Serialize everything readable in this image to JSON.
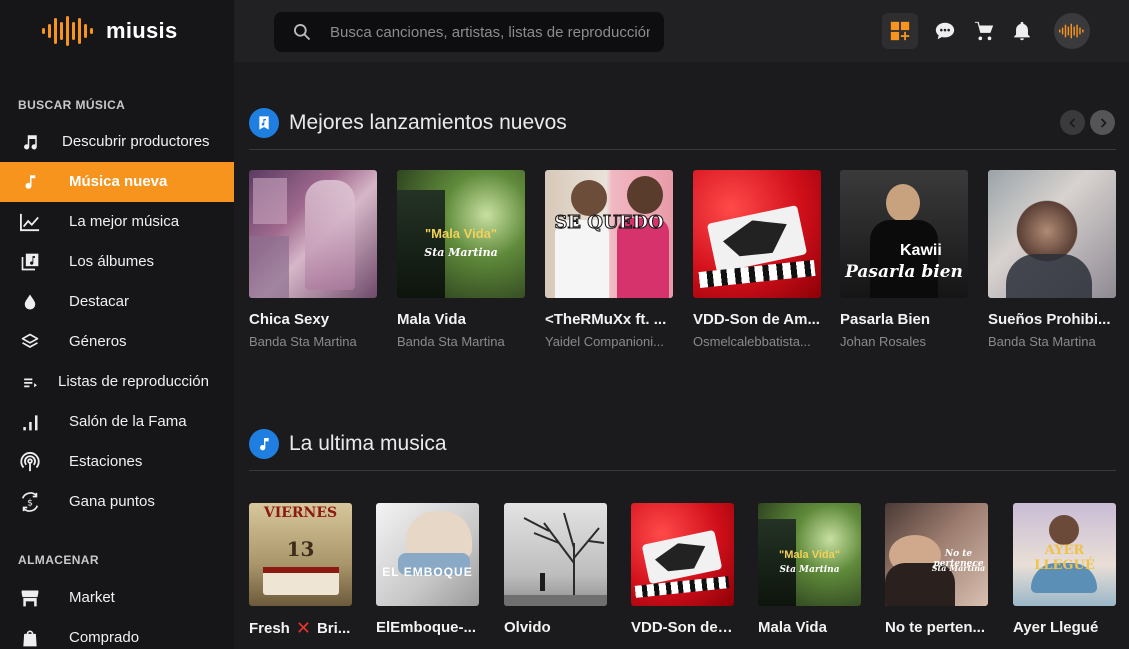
{
  "brand": {
    "name": "miusis",
    "accent": "#f7941d",
    "blue": "#1f7fe0"
  },
  "search": {
    "placeholder": "Busca canciones, artistas, listas de reproducción"
  },
  "sidebar": {
    "section_buscar": "BUSCAR MÚSICA",
    "section_almacenar": "ALMACENAR",
    "items": [
      {
        "label": "Descubrir productores",
        "icon": "music-note-icon"
      },
      {
        "label": "Música nueva",
        "icon": "music-note-icon",
        "active": true
      },
      {
        "label": "La mejor música",
        "icon": "chart-line-icon"
      },
      {
        "label": "Los álbumes",
        "icon": "album-icon"
      },
      {
        "label": "Destacar",
        "icon": "drop-icon"
      },
      {
        "label": "Géneros",
        "icon": "layers-icon"
      },
      {
        "label": "Listas de reproducción",
        "icon": "playlist-icon"
      },
      {
        "label": "Salón de la Fama",
        "icon": "bar-chart-icon"
      },
      {
        "label": "Estaciones",
        "icon": "podcast-icon"
      },
      {
        "label": "Gana puntos",
        "icon": "coin-icon"
      }
    ],
    "store_items": [
      {
        "label": "Market",
        "icon": "store-icon"
      },
      {
        "label": "Comprado",
        "icon": "shopping-bag-icon"
      }
    ]
  },
  "main": {
    "section1": {
      "title": "Mejores lanzamientos nuevos",
      "cards": [
        {
          "title": "Chica Sexy",
          "artist": "Banda Sta Martina",
          "cover_text": ""
        },
        {
          "title": "Mala Vida",
          "artist": "Banda Sta Martina",
          "cover_text": "\"Mala Vida\"",
          "cover_sub": "Sta Martina"
        },
        {
          "title": "<TheRMuXx ft. ...",
          "artist": "Yaidel Companioni...",
          "cover_text": "SE QUEDO"
        },
        {
          "title": "VDD-Son de Am...",
          "artist": "Osmelcalebbatista...",
          "cover_text": ""
        },
        {
          "title": "Pasarla Bien",
          "artist": "Johan Rosales",
          "cover_text": "Kawii",
          "cover_sub": "Pasarla bien"
        },
        {
          "title": "Sueños Prohibi...",
          "artist": "Banda Sta Martina",
          "cover_text": ""
        }
      ]
    },
    "section2": {
      "title": "La ultima musica",
      "cards": [
        {
          "title": "Fresh",
          "title_end": "Bri...",
          "cover_text": "VIERNES",
          "cover_sub": "13"
        },
        {
          "title": "ElEmboque-...",
          "cover_text": "EL EMBOQUE"
        },
        {
          "title": "Olvido",
          "cover_text": ""
        },
        {
          "title": "VDD-Son de ...",
          "cover_text": ""
        },
        {
          "title": "Mala Vida",
          "cover_text": "\"Mala Vida\"",
          "cover_sub": "Sta Martina"
        },
        {
          "title": "No te perten...",
          "cover_text": "No te pertenece",
          "cover_sub": "Sta Martina"
        },
        {
          "title": "Ayer Llegué",
          "cover_text": "AYER LLEGUÉ"
        }
      ]
    }
  }
}
